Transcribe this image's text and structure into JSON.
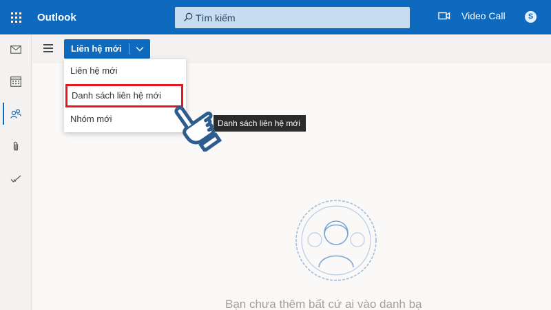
{
  "header": {
    "app_name": "Outlook",
    "search_placeholder": "Tìm kiếm",
    "video_call_label": "Video Call",
    "skype_glyph": "S"
  },
  "toolbar": {
    "new_contact_label": "Liên hệ mới"
  },
  "dropdown": {
    "items": [
      {
        "label": "Liên hệ mới"
      },
      {
        "label": "Danh sách liên hệ mới"
      },
      {
        "label": "Nhóm mới"
      }
    ]
  },
  "tooltip": "Danh sách liên hệ mới",
  "empty_state": {
    "message": "Bạn chưa thêm bất cứ ai vào danh bạ"
  },
  "rail": {
    "items": [
      "mail-icon",
      "calendar-icon",
      "people-icon",
      "attachment-icon",
      "todo-icon"
    ],
    "active": "people-icon"
  },
  "colors": {
    "brand": "#0e6abf",
    "highlight": "#e8161c",
    "hand": "#2d5d8f"
  }
}
